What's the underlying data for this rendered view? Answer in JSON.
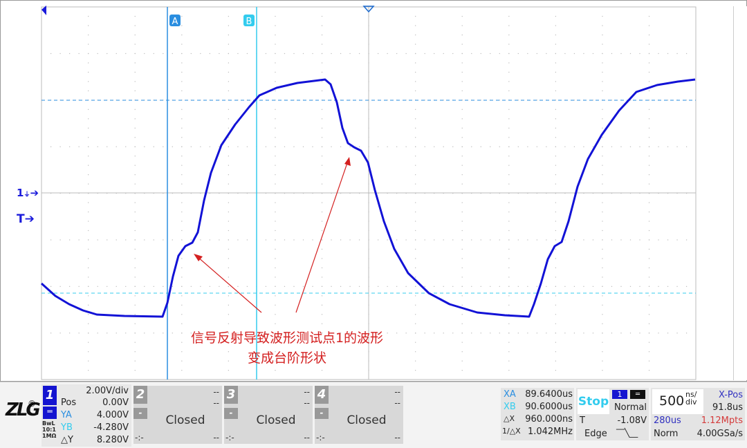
{
  "scope": {
    "cursor_a": "A",
    "cursor_b": "B",
    "channel_marker": "1",
    "trigger_marker": "T",
    "trace_color": "#1212d6",
    "cursor_a_color": "#2a8ee0",
    "cursor_b_color": "#33ccee",
    "annotation_line1": "信号反射导致波形测试点1的波形",
    "annotation_line2": "变成台阶形状",
    "annotation_color": "#d42020"
  },
  "bottom": {
    "logo": "ZLG",
    "logo_reg": "®",
    "ch1": {
      "num": "1",
      "scale": "2.00V/div",
      "pos_label": "Pos",
      "pos": "0.00V",
      "ya_label": "YA",
      "ya": "4.000V",
      "yb_label": "YB",
      "yb": "-4.280V",
      "dy_label": "△Y",
      "dy": "8.280V",
      "bwl": "BwL",
      "probe": "10:1",
      "imp": "1MΩ"
    },
    "channels": [
      {
        "num": "2",
        "top1": "--",
        "top2": "--",
        "minus": "-",
        "status": "Closed",
        "bl": "-:-",
        "br": "--"
      },
      {
        "num": "3",
        "top1": "--",
        "top2": "--",
        "minus": "-",
        "status": "Closed",
        "bl": "-:-",
        "br": "--"
      },
      {
        "num": "4",
        "top1": "--",
        "top2": "--",
        "minus": "-",
        "status": "Closed",
        "bl": "-:-",
        "br": "--"
      }
    ],
    "cursors": {
      "xa_label": "XA",
      "xa": "89.6400us",
      "xb_label": "XB",
      "xb": "90.6000us",
      "dx_label": "△X",
      "dx": "960.000ns",
      "inv_label": "1/△X",
      "inv": "1.042MHz"
    },
    "run": {
      "state": "Stop",
      "trig_src": "1",
      "mode": "Normal",
      "t_label": "T",
      "t_level": "-1.08V",
      "type": "Edge"
    },
    "timebase": {
      "value": "500",
      "unit_top": "ns/",
      "unit_bot": "div",
      "xpos_label": "X-Pos",
      "xpos": "91.8us",
      "mem_time": "280us",
      "mem_pts": "1.12Mpts",
      "acq": "Norm",
      "rate": "4.00GSa/s"
    }
  }
}
